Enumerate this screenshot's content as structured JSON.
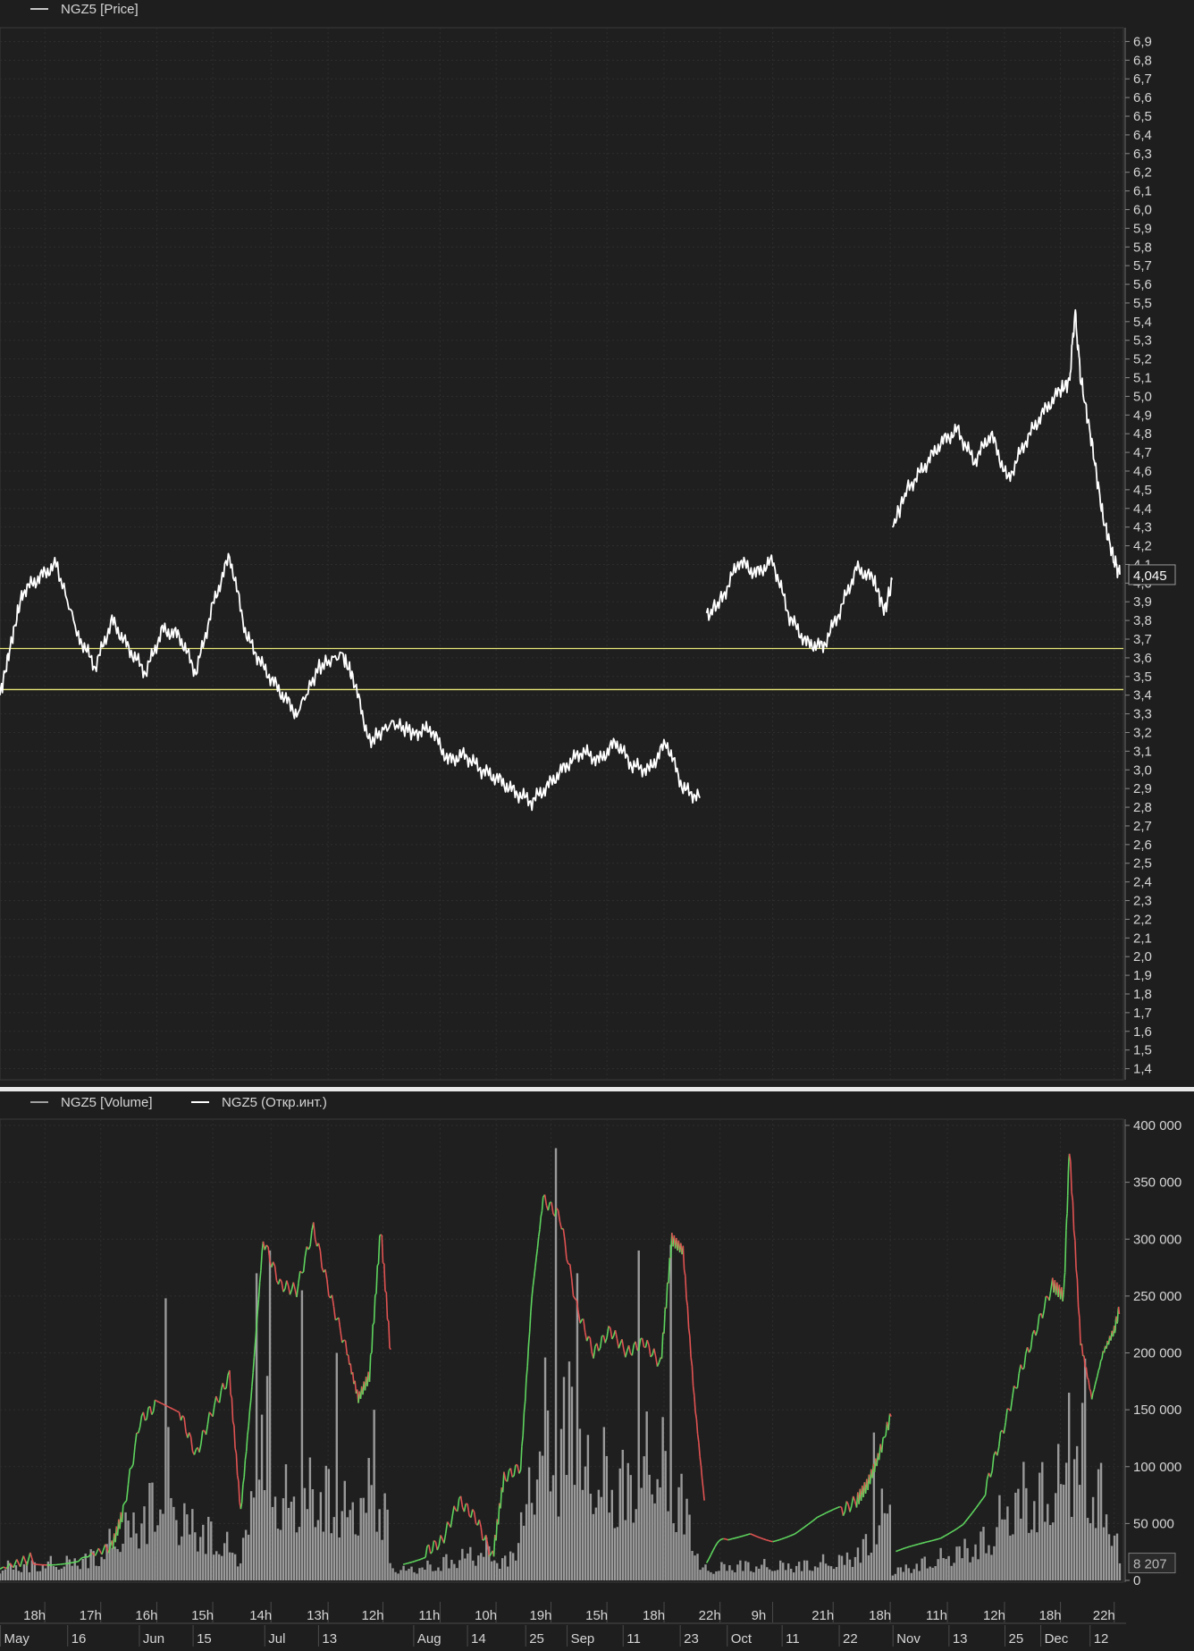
{
  "chart_data": [
    {
      "type": "line",
      "legend": [
        {
          "label": "NGZ5 [Price]",
          "color": "#ffffff"
        }
      ],
      "y_ticks": [
        "6,9",
        "6,8",
        "6,7",
        "6,6",
        "6,5",
        "6,4",
        "6,3",
        "6,2",
        "6,1",
        "6,0",
        "5,9",
        "5,8",
        "5,7",
        "5,6",
        "5,5",
        "5,4",
        "5,3",
        "5,2",
        "5,1",
        "5,0",
        "4,9",
        "4,8",
        "4,7",
        "4,6",
        "4,5",
        "4,4",
        "4,3",
        "4,2",
        "4,1",
        "4,0",
        "3,9",
        "3,8",
        "3,7",
        "3,6",
        "3,5",
        "3,4",
        "3,3",
        "3,2",
        "3,1",
        "3,0",
        "2,9",
        "2,8",
        "2,7",
        "2,6",
        "2,5",
        "2,4",
        "2,3",
        "2,2",
        "2,1",
        "2,0",
        "1,9",
        "1,8",
        "1,7",
        "1,6",
        "1,5",
        "1,4"
      ],
      "ylim": [
        1.35,
        6.95
      ],
      "last_value_label": "4,045",
      "last_value": 4.045,
      "horizontal_lines": [
        {
          "value": 3.65,
          "color": "#e8e87a"
        },
        {
          "value": 3.43,
          "color": "#e8e87a"
        }
      ],
      "series": [
        {
          "color": "#ffffff",
          "segments": [
            [
              [
                0,
                3.4
              ],
              [
                0.01,
                3.68
              ],
              [
                0.02,
                3.95
              ],
              [
                0.035,
                4.03
              ],
              [
                0.05,
                4.1
              ],
              [
                0.07,
                3.72
              ],
              [
                0.085,
                3.55
              ],
              [
                0.1,
                3.8
              ],
              [
                0.115,
                3.65
              ],
              [
                0.13,
                3.52
              ],
              [
                0.145,
                3.75
              ],
              [
                0.16,
                3.72
              ],
              [
                0.175,
                3.52
              ],
              [
                0.19,
                3.88
              ],
              [
                0.205,
                4.15
              ],
              [
                0.22,
                3.72
              ],
              [
                0.235,
                3.55
              ],
              [
                0.25,
                3.42
              ],
              [
                0.265,
                3.3
              ],
              [
                0.285,
                3.55
              ],
              [
                0.305,
                3.62
              ],
              [
                0.315,
                3.5
              ],
              [
                0.33,
                3.15
              ],
              [
                0.35,
                3.25
              ],
              [
                0.37,
                3.2
              ],
              [
                0.385,
                3.22
              ],
              [
                0.4,
                3.05
              ],
              [
                0.415,
                3.08
              ],
              [
                0.43,
                3.0
              ],
              [
                0.445,
                2.95
              ],
              [
                0.46,
                2.88
              ],
              [
                0.475,
                2.83
              ],
              [
                0.49,
                2.92
              ],
              [
                0.505,
                3.02
              ],
              [
                0.52,
                3.1
              ],
              [
                0.535,
                3.05
              ],
              [
                0.55,
                3.15
              ],
              [
                0.565,
                3.02
              ],
              [
                0.58,
                3.0
              ],
              [
                0.595,
                3.15
              ],
              [
                0.61,
                2.9
              ],
              [
                0.625,
                2.85
              ]
            ],
            [
              [
                0.631,
                3.82
              ],
              [
                0.645,
                3.92
              ],
              [
                0.66,
                4.12
              ],
              [
                0.675,
                4.05
              ],
              [
                0.69,
                4.12
              ],
              [
                0.705,
                3.82
              ],
              [
                0.72,
                3.68
              ],
              [
                0.735,
                3.66
              ],
              [
                0.75,
                3.85
              ],
              [
                0.765,
                4.08
              ],
              [
                0.78,
                4.02
              ],
              [
                0.79,
                3.85
              ],
              [
                0.797,
                4.02
              ]
            ],
            [
              [
                0.797,
                4.3
              ],
              [
                0.81,
                4.5
              ],
              [
                0.825,
                4.62
              ],
              [
                0.84,
                4.75
              ],
              [
                0.855,
                4.82
              ],
              [
                0.87,
                4.65
              ],
              [
                0.885,
                4.8
              ],
              [
                0.9,
                4.55
              ],
              [
                0.915,
                4.75
              ],
              [
                0.93,
                4.9
              ],
              [
                0.945,
                5.02
              ],
              [
                0.955,
                5.08
              ],
              [
                0.96,
                5.45
              ],
              [
                0.965,
                5.1
              ],
              [
                0.975,
                4.75
              ],
              [
                0.985,
                4.35
              ],
              [
                0.995,
                4.12
              ],
              [
                1.0,
                4.045
              ]
            ]
          ]
        }
      ]
    },
    {
      "type": "bar",
      "legend": [
        {
          "label": "NGZ5 [Volume]",
          "color": "#a0a0a0"
        },
        {
          "label": "NGZ5 (Откр.инт.)",
          "color": "#ffffff"
        }
      ],
      "y_ticks": [
        "400 000",
        "350 000",
        "300 000",
        "250 000",
        "200 000",
        "150 000",
        "100 000",
        "50 000",
        "0"
      ],
      "ylim": [
        0,
        400000
      ],
      "last_value_label": "8 207",
      "last_value": 8207,
      "volume_color": "#9a9a9a",
      "volume_profile": [
        [
          0,
          15000
        ],
        [
          0.03,
          18000
        ],
        [
          0.06,
          20000
        ],
        [
          0.09,
          30000
        ],
        [
          0.11,
          55000
        ],
        [
          0.13,
          75000
        ],
        [
          0.15,
          120000
        ],
        [
          0.16,
          70000
        ],
        [
          0.18,
          60000
        ],
        [
          0.2,
          40000
        ],
        [
          0.215,
          28000
        ],
        [
          0.225,
          80000
        ],
        [
          0.235,
          200000
        ],
        [
          0.25,
          90000
        ],
        [
          0.27,
          95000
        ],
        [
          0.285,
          110000
        ],
        [
          0.3,
          80000
        ],
        [
          0.315,
          80000
        ],
        [
          0.325,
          90000
        ],
        [
          0.335,
          110000
        ],
        [
          0.345,
          70000
        ],
        [
          0.35,
          15000
        ],
        [
          0.36,
          12000
        ],
        [
          0.38,
          15000
        ],
        [
          0.4,
          22000
        ],
        [
          0.42,
          30000
        ],
        [
          0.44,
          35000
        ],
        [
          0.45,
          18000
        ],
        [
          0.46,
          40000
        ],
        [
          0.47,
          80000
        ],
        [
          0.485,
          180000
        ],
        [
          0.5,
          130000
        ],
        [
          0.51,
          240000
        ],
        [
          0.52,
          120000
        ],
        [
          0.54,
          120000
        ],
        [
          0.555,
          110000
        ],
        [
          0.57,
          120000
        ],
        [
          0.585,
          150000
        ],
        [
          0.595,
          120000
        ],
        [
          0.61,
          90000
        ],
        [
          0.62,
          50000
        ],
        [
          0.625,
          15000
        ],
        [
          0.631,
          12000
        ],
        [
          0.66,
          18000
        ],
        [
          0.69,
          16000
        ],
        [
          0.72,
          18000
        ],
        [
          0.75,
          22000
        ],
        [
          0.77,
          35000
        ],
        [
          0.785,
          60000
        ],
        [
          0.795,
          100000
        ],
        [
          0.797,
          10000
        ],
        [
          0.82,
          18000
        ],
        [
          0.84,
          25000
        ],
        [
          0.86,
          35000
        ],
        [
          0.88,
          45000
        ],
        [
          0.9,
          80000
        ],
        [
          0.915,
          100000
        ],
        [
          0.93,
          95000
        ],
        [
          0.945,
          110000
        ],
        [
          0.955,
          120000
        ],
        [
          0.965,
          150000
        ],
        [
          0.975,
          115000
        ],
        [
          0.985,
          90000
        ],
        [
          0.995,
          60000
        ],
        [
          1.0,
          20000
        ]
      ],
      "volume_spikes": [
        [
          0.148,
          248000
        ],
        [
          0.229,
          270000
        ],
        [
          0.242,
          290000
        ],
        [
          0.27,
          255000
        ],
        [
          0.3,
          200000
        ],
        [
          0.335,
          150000
        ],
        [
          0.497,
          380000
        ],
        [
          0.515,
          270000
        ],
        [
          0.57,
          290000
        ],
        [
          0.598,
          295000
        ],
        [
          0.78,
          130000
        ],
        [
          0.955,
          165000
        ],
        [
          0.97,
          195000
        ]
      ],
      "open_interest": [
        {
          "segment": [
            [
              0,
              10000
            ],
            [
              0.03,
              20000
            ],
            [
              0.07,
              18000
            ],
            [
              0.1,
              30000
            ],
            [
              0.11,
              60000
            ],
            [
              0.125,
              140000
            ],
            [
              0.14,
              155000
            ],
            [
              0.16,
              150000
            ],
            [
              0.175,
              110000
            ],
            [
              0.19,
              150000
            ],
            [
              0.205,
              180000
            ],
            [
              0.215,
              60000
            ],
            [
              0.225,
              170000
            ],
            [
              0.235,
              300000
            ],
            [
              0.25,
              260000
            ],
            [
              0.265,
              255000
            ],
            [
              0.28,
              310000
            ],
            [
              0.295,
              250000
            ],
            [
              0.31,
              200000
            ],
            [
              0.32,
              160000
            ],
            [
              0.33,
              180000
            ],
            [
              0.34,
              310000
            ],
            [
              0.35,
              185000
            ]
          ],
          "color_up": "#5ed45e",
          "color_down": "#e05252"
        },
        {
          "segment": [
            [
              0.36,
              20000
            ],
            [
              0.38,
              25000
            ],
            [
              0.395,
              35000
            ],
            [
              0.41,
              70000
            ],
            [
              0.425,
              55000
            ],
            [
              0.44,
              20000
            ],
            [
              0.45,
              90000
            ],
            [
              0.465,
              100000
            ],
            [
              0.475,
              250000
            ],
            [
              0.485,
              335000
            ],
            [
              0.5,
              320000
            ],
            [
              0.515,
              240000
            ],
            [
              0.53,
              200000
            ],
            [
              0.545,
              220000
            ],
            [
              0.56,
              200000
            ],
            [
              0.575,
              210000
            ],
            [
              0.59,
              190000
            ],
            [
              0.6,
              300000
            ],
            [
              0.61,
              290000
            ],
            [
              0.62,
              160000
            ],
            [
              0.63,
              60000
            ]
          ],
          "color_up": "#5ed45e",
          "color_down": "#e05252"
        },
        {
          "segment": [
            [
              0.631,
              20000
            ],
            [
              0.65,
              35000
            ],
            [
              0.67,
              45000
            ],
            [
              0.69,
              40000
            ],
            [
              0.71,
              45000
            ],
            [
              0.73,
              55000
            ],
            [
              0.75,
              60000
            ],
            [
              0.765,
              70000
            ],
            [
              0.775,
              85000
            ],
            [
              0.785,
              110000
            ],
            [
              0.797,
              150000
            ]
          ],
          "color_up": "#5ed45e",
          "color_down": "#e05252"
        },
        {
          "segment": [
            [
              0.8,
              20000
            ],
            [
              0.82,
              30000
            ],
            [
              0.84,
              40000
            ],
            [
              0.86,
              55000
            ],
            [
              0.88,
              80000
            ],
            [
              0.895,
              130000
            ],
            [
              0.91,
              180000
            ],
            [
              0.925,
              220000
            ],
            [
              0.94,
              260000
            ],
            [
              0.95,
              250000
            ],
            [
              0.955,
              380000
            ],
            [
              0.965,
              210000
            ],
            [
              0.975,
              160000
            ],
            [
              0.985,
              200000
            ],
            [
              0.995,
              220000
            ],
            [
              1.0,
              240000
            ]
          ],
          "color_up": "#5ed45e",
          "color_down": "#e05252"
        }
      ]
    }
  ],
  "x_axis": {
    "top_row": [
      {
        "label": "18h",
        "pos": 0.04
      },
      {
        "label": "17h",
        "pos": 0.09
      },
      {
        "label": "16h",
        "pos": 0.14
      },
      {
        "label": "15h",
        "pos": 0.19
      },
      {
        "label": "14h",
        "pos": 0.242
      },
      {
        "label": "13h",
        "pos": 0.293
      },
      {
        "label": "12h",
        "pos": 0.342
      },
      {
        "label": "11h",
        "pos": 0.393
      },
      {
        "label": "10h",
        "pos": 0.443
      },
      {
        "label": "19h",
        "pos": 0.492
      },
      {
        "label": "15h",
        "pos": 0.542
      },
      {
        "label": "18h",
        "pos": 0.593
      },
      {
        "label": "22h",
        "pos": 0.643
      },
      {
        "label": "9h",
        "pos": 0.69
      },
      {
        "label": "21h",
        "pos": 0.744
      },
      {
        "label": "18h",
        "pos": 0.795
      },
      {
        "label": "11h",
        "pos": 0.846
      },
      {
        "label": "12h",
        "pos": 0.897
      },
      {
        "label": "18h",
        "pos": 0.947
      },
      {
        "label": "22h",
        "pos": 0.995
      }
    ],
    "bottom_row": [
      {
        "label": "May",
        "pos": 0.018
      },
      {
        "label": "16",
        "pos": 0.078
      },
      {
        "label": "Jun",
        "pos": 0.142
      },
      {
        "label": "15",
        "pos": 0.19
      },
      {
        "label": "Jul",
        "pos": 0.254
      },
      {
        "label": "13",
        "pos": 0.302
      },
      {
        "label": "Aug",
        "pos": 0.387
      },
      {
        "label": "14",
        "pos": 0.435
      },
      {
        "label": "25",
        "pos": 0.487
      },
      {
        "label": "Sep",
        "pos": 0.524
      },
      {
        "label": "11",
        "pos": 0.574
      },
      {
        "label": "23",
        "pos": 0.625
      },
      {
        "label": "Oct",
        "pos": 0.667
      },
      {
        "label": "11",
        "pos": 0.716
      },
      {
        "label": "22",
        "pos": 0.767
      },
      {
        "label": "Nov",
        "pos": 0.815
      },
      {
        "label": "13",
        "pos": 0.865
      },
      {
        "label": "25",
        "pos": 0.915
      },
      {
        "label": "Dec",
        "pos": 0.947
      },
      {
        "label": "12",
        "pos": 0.991
      }
    ]
  }
}
